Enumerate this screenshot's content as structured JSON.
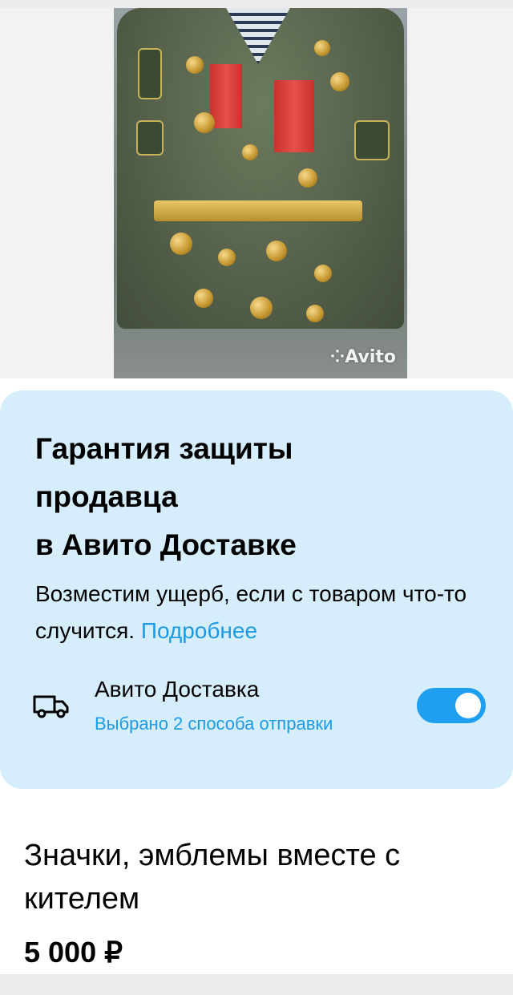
{
  "listing_photo": {
    "watermark": "Avito"
  },
  "guarantee_card": {
    "title_line1": "Гарантия защиты",
    "title_line2": "продавца",
    "title_line3": "в Авито Доставке",
    "description": "Возместим ущерб, если с товаром что-то случится.",
    "more_link": "Подробнее",
    "delivery": {
      "icon": "truck-icon",
      "name": "Авито Доставка",
      "subtitle": "Выбрано 2 способа отправки",
      "enabled": true
    }
  },
  "listing": {
    "title": "Значки, эмблемы вместе с кителем",
    "price": "5 000 ₽"
  },
  "colors": {
    "card_bg": "#d6eefc",
    "link": "#1b9be4",
    "toggle_on": "#1f9ff0"
  }
}
